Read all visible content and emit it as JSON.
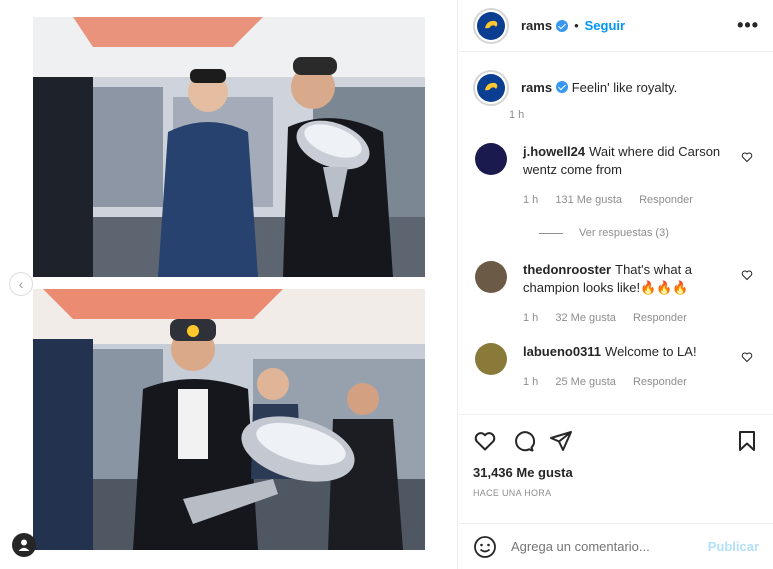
{
  "post": {
    "username": "rams",
    "follow_label": "Seguir",
    "more_label": "•••",
    "caption": "Feelin' like royalty.",
    "caption_time": "1 h"
  },
  "comments": [
    {
      "user": "j.howell24",
      "text": "Wait where did Carson wentz come from",
      "time": "1 h",
      "likes": "131 Me gusta",
      "reply": "Responder",
      "avatar_color": "#1a1a4e"
    },
    {
      "user": "thedonrooster",
      "text": "That's what a champion looks like!🔥🔥🔥",
      "time": "1 h",
      "likes": "32 Me gusta",
      "reply": "Responder",
      "avatar_color": "#6b5a45"
    },
    {
      "user": "labueno0311",
      "text": "Welcome to LA!",
      "time": "1 h",
      "likes": "25 Me gusta",
      "reply": "Responder",
      "avatar_color": "#8a7a3a"
    }
  ],
  "view_replies": "Ver respuestas (3)",
  "likes_count": "31,436 Me gusta",
  "posted_ago": "HACE UNA HORA",
  "comment_input": {
    "placeholder": "Agrega un comentario..."
  },
  "publish_label": "Publicar",
  "colors": {
    "accent": "#0095f6",
    "publish_disabled": "#b2dffc",
    "rams_blue": "#0b3d91",
    "rams_gold": "#ffc72c"
  },
  "icons": [
    "heart-icon",
    "comment-icon",
    "share-icon",
    "bookmark-icon",
    "emoji-icon",
    "more-icon",
    "verified-icon",
    "user-tag-icon",
    "chevron-left-icon"
  ]
}
